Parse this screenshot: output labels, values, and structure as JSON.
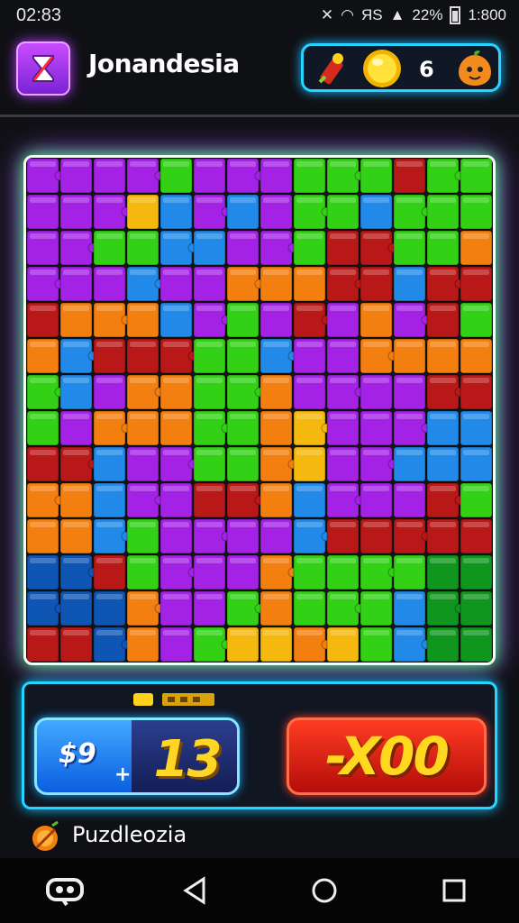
{
  "status_bar": {
    "time": "02:83",
    "signal_text": "ЯS",
    "battery_percent": "22%",
    "clock_right": "1:800"
  },
  "header": {
    "app_icon": "hourglass-icon",
    "title": "Jonandesia",
    "resources": {
      "left_icon": "firework-icon",
      "coin_icon": "coin-icon",
      "coin_count": "6",
      "right_icon": "fruit-mascot-icon"
    }
  },
  "board": {
    "rows": 14,
    "cols": 14,
    "colors": {
      "P": "#a322e6",
      "G": "#33d116",
      "O": "#f27f10",
      "R": "#b91818",
      "B": "#2189e8",
      "Y": "#f5b80f",
      "D": "#0f55b3",
      "K": "#10961e"
    },
    "grid": [
      "PPPPGPPPGGGRGG",
      "PPPYBPBPGGBGGG",
      "PPGGBBPPGRRGGO",
      "PPPBPPOOORRBRR",
      "ROOOBPGPRPOPRG",
      "OBRRRGGBPPOOOO",
      "GBPOOGGOPPPPRR",
      "GPOOOGGOYPPPBB",
      "RRBPPGGOYPPBBB",
      "OOBPPRROBPPPRG",
      "OOBGPPPPBRRRRR",
      "DDRGPPPOGGGGKK",
      "DDDOPPGOGGGBKK",
      "RRDOPGYYOYGBKK"
    ]
  },
  "bottom_panel": {
    "small_icon": "ticket-icon",
    "score_prefix": "$9",
    "score_plus": "+",
    "score_value": "13",
    "penalty_value": "-X00"
  },
  "footer": {
    "icon": "orange-bomb-icon",
    "label": "Puzdleozia"
  },
  "nav": {
    "buttons": [
      "recent-icon",
      "back-icon",
      "home-icon",
      "overview-icon"
    ]
  }
}
